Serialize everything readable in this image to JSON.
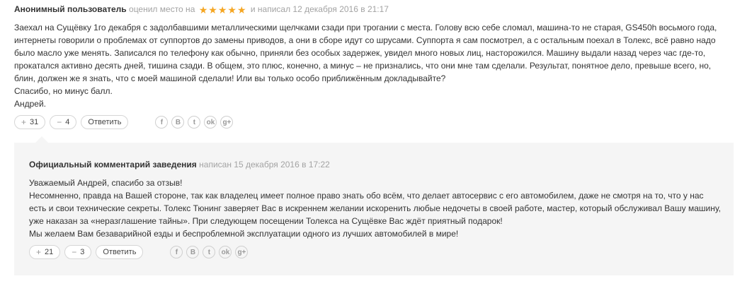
{
  "review": {
    "author": "Анонимный пользователь",
    "rated_text": "оценил место на",
    "rating": 5,
    "wrote_text": "и написал 12 декабря 2016 в 21:17",
    "body": [
      "Заехал на Сущёвку 1го декабря с задолбавшими металлическими щелчками сзади при трогании с места. Голову всю себе сломал, машина-то не старая, GS450h восьмого года, интернеты говорили о проблемах от суппортов до замены приводов, а они в сборе идут со шрусами. Суппорта я сам посмотрел, а с остальным поехал в Толекс, всё равно надо было масло уже менять. Записался по телефону как обычно, приняли без особых задержек, увидел много новых лиц, насторожился. Машину выдали назад через час где-то, прокатался активно десять дней, тишина сзади. В общем, это плюс, конечно, а минус – не признались, что они мне там сделали. Результат, понятное дело, превыше всего, но, блин, должен же я знать, что с моей машиной сделали! Или вы только особо приближённым докладывайте?",
      "Спасибо, но минус балл.",
      "Андрей."
    ],
    "likes": "31",
    "dislikes": "4",
    "reply_label": "Ответить"
  },
  "official": {
    "title": "Официальный комментарий заведения",
    "wrote_text": "написан 15 декабря 2016 в 17:22",
    "body": [
      "Уважаемый Андрей, спасибо за отзыв!",
      "Несомненно, правда на Вашей стороне, так как владелец имеет полное право знать обо всём, что делает автосервис с его автомобилем, даже не смотря на то, что у нас есть и свои технические секреты. Толекс Тюнинг заверяет Вас в искреннем желании искоренить любые недочеты в своей работе, мастер, который обслуживал Вашу машину, уже наказан за «неразглашение тайны». При следующем посещении Толекса на Сущёвке Вас ждёт приятный подарок!",
      "Мы желаем Вам безаварийной езды и беспроблемной эксплуатации одного из лучших автомобилей в мире!"
    ],
    "likes": "21",
    "dislikes": "3",
    "reply_label": "Ответить"
  },
  "ui": {
    "plus_symbol": "+",
    "minus_symbol": "−",
    "star_glyph": "★",
    "star_color": "#f5a623"
  },
  "social": [
    {
      "icon": "facebook-icon",
      "glyph": "f"
    },
    {
      "icon": "vkontakte-icon",
      "glyph": "B"
    },
    {
      "icon": "twitter-icon",
      "glyph": "t"
    },
    {
      "icon": "odnoklassniki-icon",
      "glyph": "ok"
    },
    {
      "icon": "google-plus-icon",
      "glyph": "g+"
    }
  ]
}
